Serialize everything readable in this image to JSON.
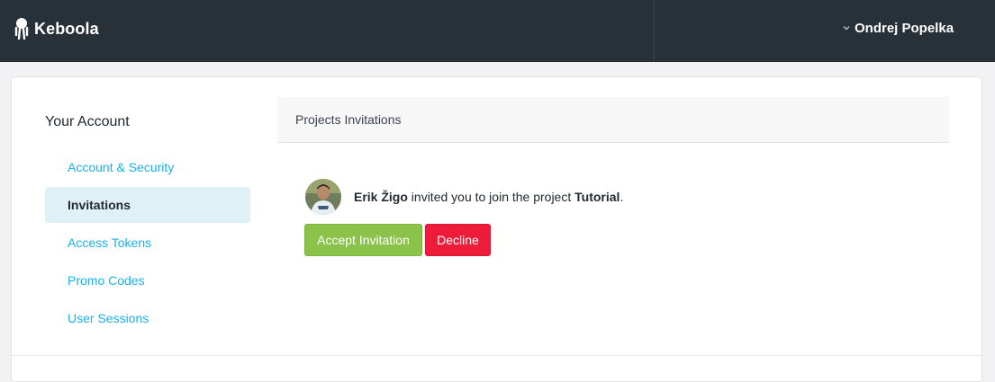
{
  "brand": {
    "name": "Keboola",
    "logo_icon": "octopus-logo-icon"
  },
  "header": {
    "user_name": "Ondrej Popelka",
    "user_menu_icon": "chevron-down-icon"
  },
  "sidebar": {
    "title": "Your Account",
    "items": [
      {
        "label": "Account & Security",
        "active": false
      },
      {
        "label": "Invitations",
        "active": true
      },
      {
        "label": "Access Tokens",
        "active": false
      },
      {
        "label": "Promo Codes",
        "active": false
      },
      {
        "label": "User Sessions",
        "active": false
      }
    ]
  },
  "main": {
    "panel_title": "Projects Invitations",
    "invitation": {
      "inviter": "Erik Žigo",
      "message": " invited you to join the project ",
      "project": "Tutorial",
      "suffix": ".",
      "accept_label": "Accept Invitation",
      "decline_label": "Decline"
    }
  },
  "colors": {
    "topbar": "#283038",
    "link": "#1ab1e6",
    "active_nav_bg": "#dff0f6",
    "accept": "#8bc34a",
    "decline": "#ed1c3a"
  }
}
